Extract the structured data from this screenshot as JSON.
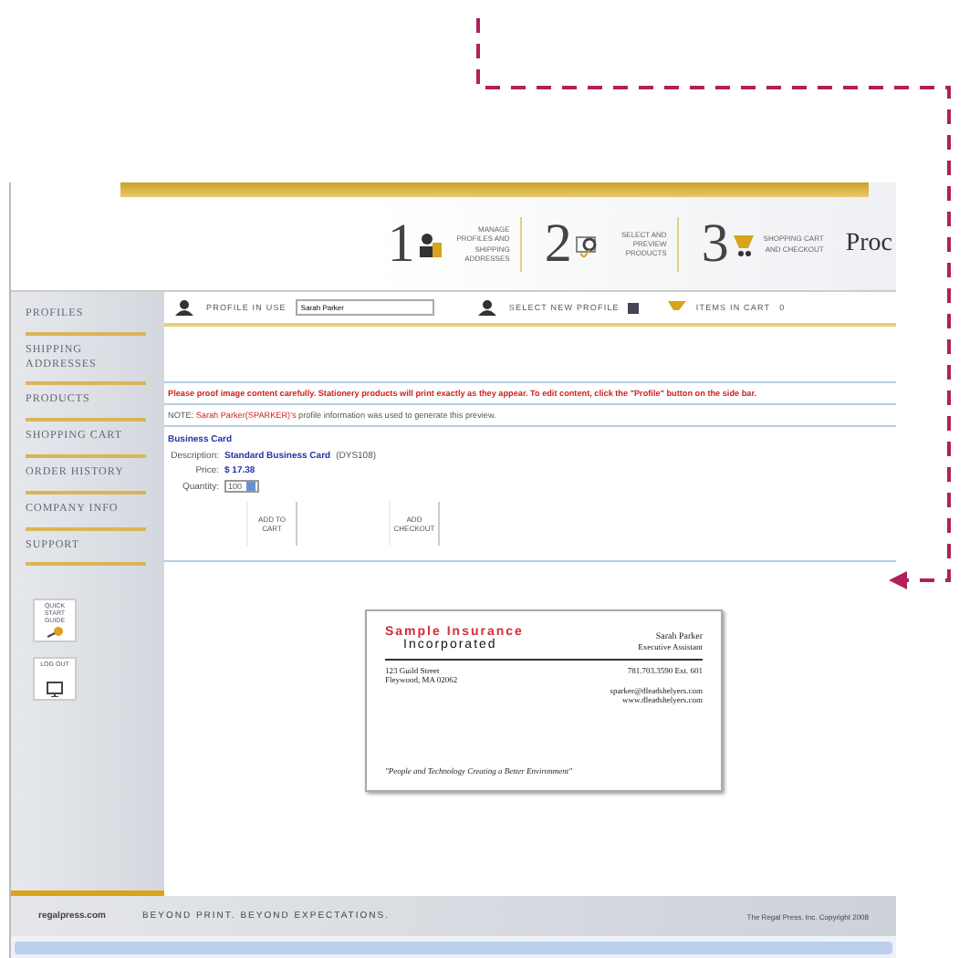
{
  "steps": [
    {
      "number": "1",
      "label": "MANAGE PROFILES AND SHIPPING ADDRESSES",
      "kind": "profile"
    },
    {
      "number": "2",
      "label": "SELECT AND PREVIEW PRODUCTS",
      "kind": "preview"
    },
    {
      "number": "3",
      "label": "SHOPPING CART AND CHECKOUT",
      "kind": "cart"
    }
  ],
  "brand_partial": "Proc",
  "sidebar": {
    "items": [
      {
        "label": "PROFILES"
      },
      {
        "label": "SHIPPING ADDRESSES"
      },
      {
        "label": "PRODUCTS"
      },
      {
        "label": "SHOPPING CART"
      },
      {
        "label": "ORDER HISTORY"
      },
      {
        "label": "COMPANY INFO"
      },
      {
        "label": "SUPPORT"
      }
    ],
    "tiles": [
      {
        "label": "QUICK START GUIDE",
        "kind": "guide"
      },
      {
        "label": "LOG OUT",
        "kind": "logout"
      }
    ]
  },
  "toolbar": {
    "profile_label": "PROFILE IN USE",
    "profile_value": "Sarah Parker",
    "select_label": "SELECT NEW PROFILE",
    "cart_label": "ITEMS IN CART",
    "cart_count": "0"
  },
  "warning": "Please proof image content carefully. Stationery products will print exactly as they appear. To edit content, click the \"Profile\" button on the side bar.",
  "note": {
    "prefix": "NOTE:",
    "name": "Sarah Parker(SPARKER)'s",
    "rest": "profile information was used to generate this preview."
  },
  "product": {
    "title": "Business Card",
    "description_label": "Description:",
    "description": "Standard Business Card",
    "code": "(DYS108)",
    "price_label": "Price:",
    "price": "$ 17.38",
    "quantity_label": "Quantity:",
    "quantity": "100"
  },
  "buttons": [
    "ADD TO CART",
    "ADD CHECKOUT"
  ],
  "card": {
    "company_line1": "Sample Insurance",
    "company_line2": "Incorporated",
    "name": "Sarah Parker",
    "title": "Executive Assistant",
    "address1": "123 Guild Street",
    "address2": "Fleywood, MA 02062",
    "phone": "781.703.3590 Ext. 601",
    "email": "sparker@dleadshelyers.com",
    "web": "www.dleadshelyers.com",
    "slogan": "\"People and Technology Creating a Better Environment\""
  },
  "footer": {
    "site": "regalpress.com",
    "tagline": "BEYOND PRINT.  BEYOND EXPECTATIONS.",
    "copyright": "The Regal Press, Inc. Copyright 2008"
  }
}
